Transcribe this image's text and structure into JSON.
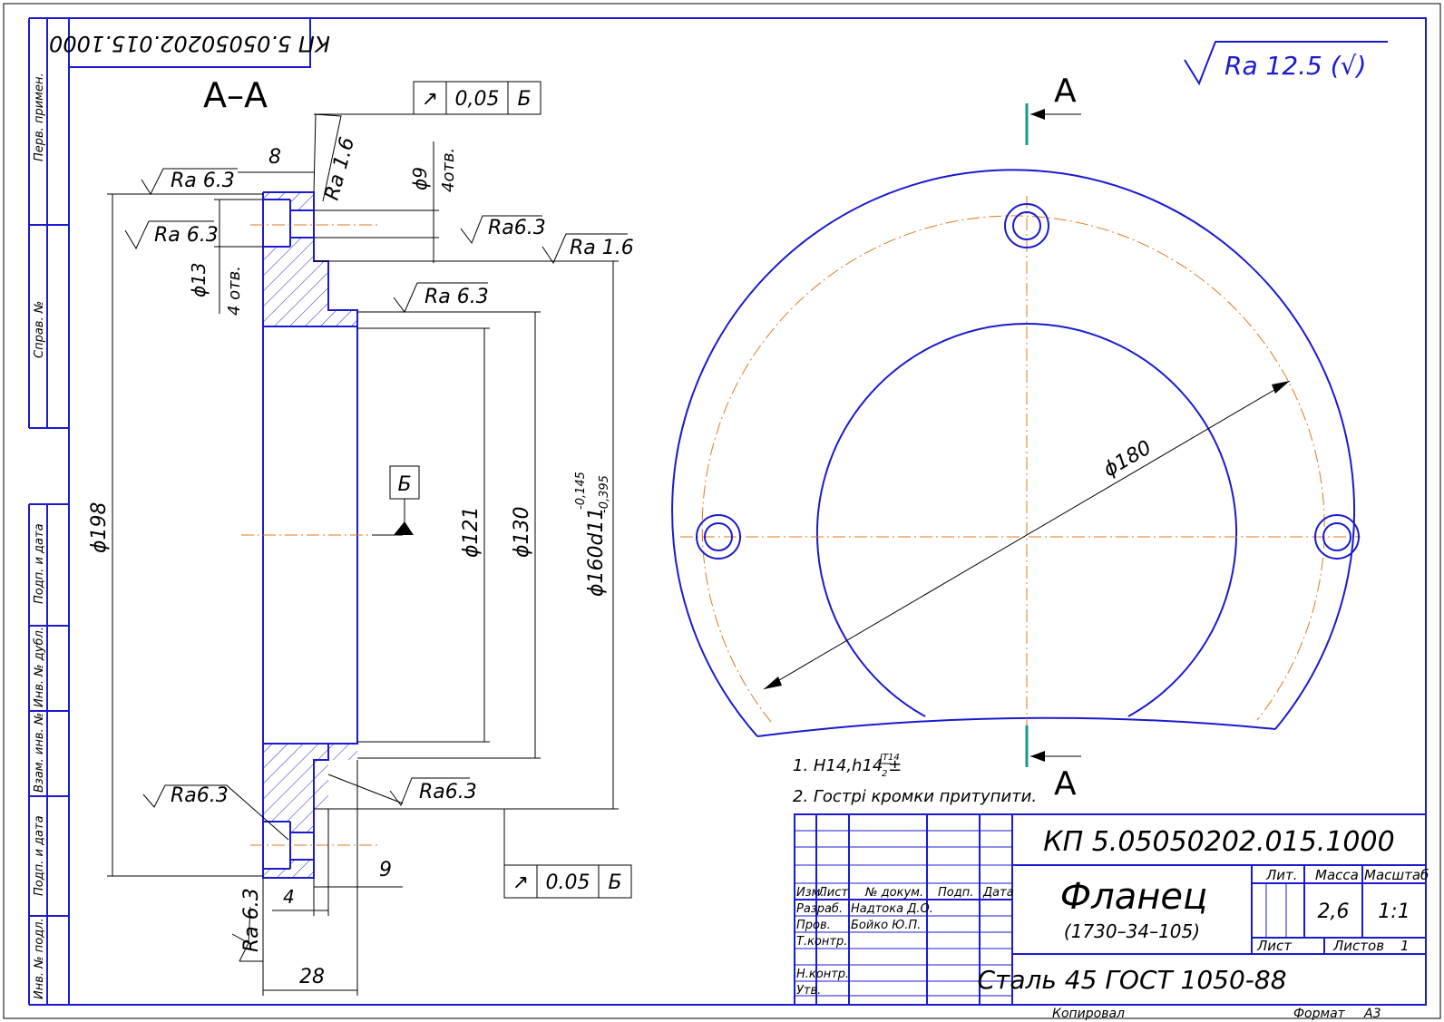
{
  "document_code": "КП 5.05050202.015.1000",
  "document_code_mirrored": "КП 5.05050202.015.1000",
  "section_label": "А–А",
  "view_arrow_label": "А",
  "general_roughness": "Ra 12.5 (√)",
  "tolerance_frames": [
    {
      "symbol": "↗",
      "value": "0,05",
      "datum": "Б"
    },
    {
      "symbol": "↗",
      "value": "0.05",
      "datum": "Б"
    }
  ],
  "datum_label": "Б",
  "dimensions": {
    "d198": "ϕ198",
    "d121": "ϕ121",
    "d130": "ϕ130",
    "d160": "ϕ160d11",
    "d160_upper": "-0,145",
    "d160_lower": "-0,395",
    "d180": "ϕ180",
    "d9": "ϕ9",
    "holes_4": "4отв.",
    "d13": "ϕ13",
    "holes_4b": "4 отв.",
    "w8": "8",
    "w9": "9",
    "w4": "4",
    "w28": "28"
  },
  "roughness_marks": [
    "Ra 6.3",
    "Ra 6.3",
    "Ra6.3",
    "Ra 1.6",
    "Ra 6.3",
    "Ra 1.6",
    "Ra6.3",
    "Ra6.3",
    "Ra 6.3"
  ],
  "notes": [
    "1. H14,h14 ±",
    "IT14",
    "2",
    "2. Гострі кромки притупити."
  ],
  "side_stamp": [
    "Перв. примен.",
    "Справ. №",
    "Подп. и дата",
    "Инв. № дубл.",
    "Взам. инв. №",
    "Подп. и дата",
    "Инв. № подл."
  ],
  "title_block": {
    "code": "КП 5.05050202.015.1000",
    "name": "Фланец",
    "subname": "(1730–34–105)",
    "material": "Сталь 45 ГОСТ 1050-88",
    "lit_header": "Лит.",
    "mass_header": "Масса",
    "scale_header": "Масштаб",
    "mass": "2,6",
    "scale": "1:1",
    "sheet_label": "Лист",
    "sheets_label": "Листов",
    "sheets_count": "1",
    "cols": [
      "Изм.",
      "Лист",
      "№ докум.",
      "Подп.",
      "Дата"
    ],
    "rows": [
      {
        "role": "Разраб.",
        "name": "Надтока Д.О."
      },
      {
        "role": "Пров.",
        "name": "Бойко Ю.П."
      },
      {
        "role": "Т.контр.",
        "name": ""
      },
      {
        "role": "Н.контр.",
        "name": ""
      },
      {
        "role": "Утв.",
        "name": ""
      }
    ],
    "copied": "Копировал",
    "format": "Формат",
    "format_value": "А3"
  }
}
